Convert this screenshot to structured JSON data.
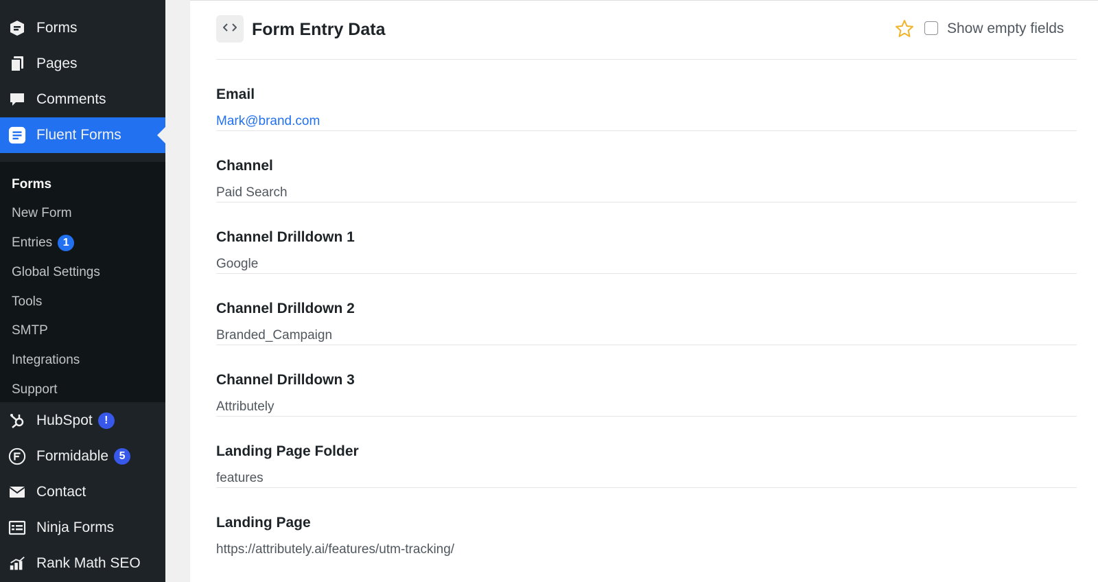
{
  "sidebar": {
    "menu": [
      {
        "label": "Forms",
        "icon": "form-icon"
      },
      {
        "label": "Pages",
        "icon": "pages-icon"
      },
      {
        "label": "Comments",
        "icon": "comments-icon"
      },
      {
        "label": "Fluent Forms",
        "icon": "fluent-forms-icon",
        "active": true
      }
    ],
    "submenu": [
      {
        "label": "Forms",
        "current": true
      },
      {
        "label": "New Form"
      },
      {
        "label": "Entries",
        "badge": "1"
      },
      {
        "label": "Global Settings"
      },
      {
        "label": "Tools"
      },
      {
        "label": "SMTP"
      },
      {
        "label": "Integrations"
      },
      {
        "label": "Support"
      }
    ],
    "menu_lower": [
      {
        "label": "HubSpot",
        "icon": "hubspot-icon",
        "badge": "!"
      },
      {
        "label": "Formidable",
        "icon": "formidable-icon",
        "badge": "5"
      },
      {
        "label": "Contact",
        "icon": "envelope-icon"
      },
      {
        "label": "Ninja Forms",
        "icon": "ninja-forms-icon"
      },
      {
        "label": "Rank Math SEO",
        "icon": "rank-math-icon"
      }
    ]
  },
  "header": {
    "title": "Form Entry Data",
    "show_empty_label": "Show empty fields"
  },
  "fields": [
    {
      "label": "Email",
      "value": "Mark@brand.com",
      "link": true
    },
    {
      "label": "Channel",
      "value": "Paid Search"
    },
    {
      "label": "Channel Drilldown 1",
      "value": "Google"
    },
    {
      "label": "Channel Drilldown 2",
      "value": "Branded_Campaign"
    },
    {
      "label": "Channel Drilldown 3",
      "value": "Attributely"
    },
    {
      "label": "Landing Page Folder",
      "value": "features"
    },
    {
      "label": "Landing Page",
      "value": "https://attributely.ai/features/utm-tracking/"
    }
  ],
  "colors": {
    "accent": "#2271f1",
    "sidebar_bg": "#1d2327",
    "star": "#f0b429"
  }
}
